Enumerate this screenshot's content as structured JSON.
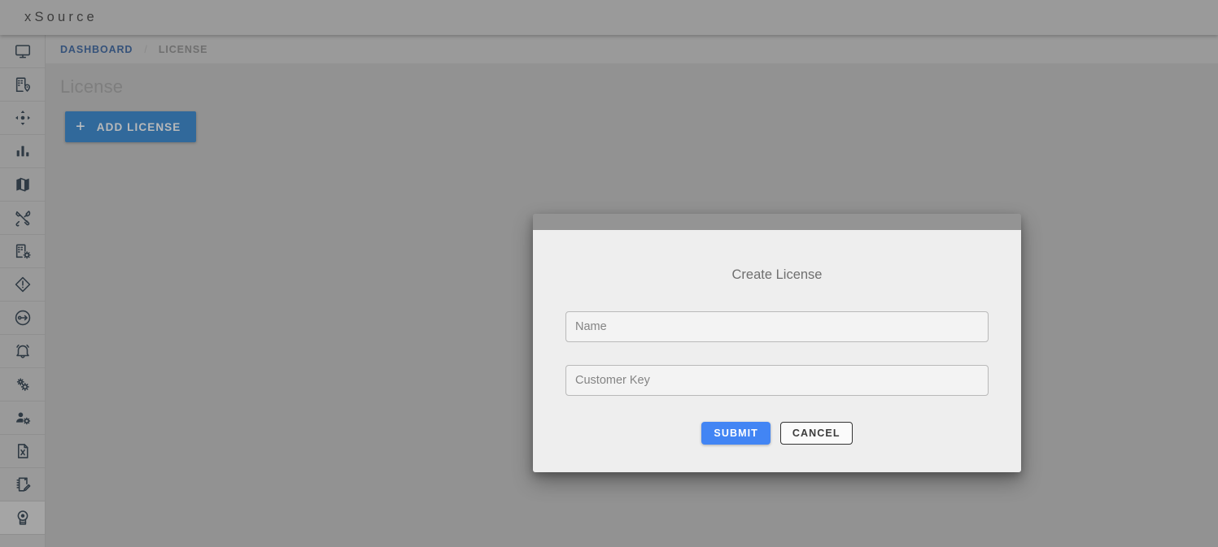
{
  "header": {
    "brand": "xSource"
  },
  "sidebar": {
    "items": [
      {
        "icon": "monitor-icon",
        "name": "sidebar-item-dashboard",
        "active": false
      },
      {
        "icon": "building-pin-icon",
        "name": "sidebar-item-sites",
        "active": false
      },
      {
        "icon": "move-arrows-icon",
        "name": "sidebar-item-assets",
        "active": false
      },
      {
        "icon": "bar-chart-icon",
        "name": "sidebar-item-analytics",
        "active": false
      },
      {
        "icon": "map-icon",
        "name": "sidebar-item-map",
        "active": false
      },
      {
        "icon": "tools-icon",
        "name": "sidebar-item-maintenance",
        "active": false
      },
      {
        "icon": "building-gear-icon",
        "name": "sidebar-item-building-settings",
        "active": false
      },
      {
        "icon": "diamond-alert-icon",
        "name": "sidebar-item-alerts",
        "active": false
      },
      {
        "icon": "login-arrow-icon",
        "name": "sidebar-item-access",
        "active": false
      },
      {
        "icon": "bell-icon",
        "name": "sidebar-item-notifications",
        "active": false
      },
      {
        "icon": "gears-icon",
        "name": "sidebar-item-settings",
        "active": false
      },
      {
        "icon": "user-gear-icon",
        "name": "sidebar-item-users",
        "active": false
      },
      {
        "icon": "file-x-icon",
        "name": "sidebar-item-export",
        "active": false
      },
      {
        "icon": "notebook-pen-icon",
        "name": "sidebar-item-reports",
        "active": false
      },
      {
        "icon": "award-badge-icon",
        "name": "sidebar-item-license",
        "active": true
      }
    ]
  },
  "breadcrumb": {
    "parent": "DASHBOARD",
    "separator": "/",
    "current": "LICENSE"
  },
  "main": {
    "page_title": "License",
    "add_button": {
      "label": "ADD LICENSE",
      "plus": "+"
    }
  },
  "dialog": {
    "title": "Create License",
    "fields": [
      {
        "name": "name-field",
        "placeholder": "Name",
        "value": ""
      },
      {
        "name": "customer-key-field",
        "placeholder": "Customer Key",
        "value": ""
      }
    ],
    "submit_label": "SUBMIT",
    "cancel_label": "CANCEL"
  },
  "colors": {
    "accent_blue": "#4285f4",
    "button_blue": "#31699b",
    "breadcrumb_link": "#35527a",
    "overlay_gray": "#929292",
    "dialog_bg": "#eeeeee"
  }
}
